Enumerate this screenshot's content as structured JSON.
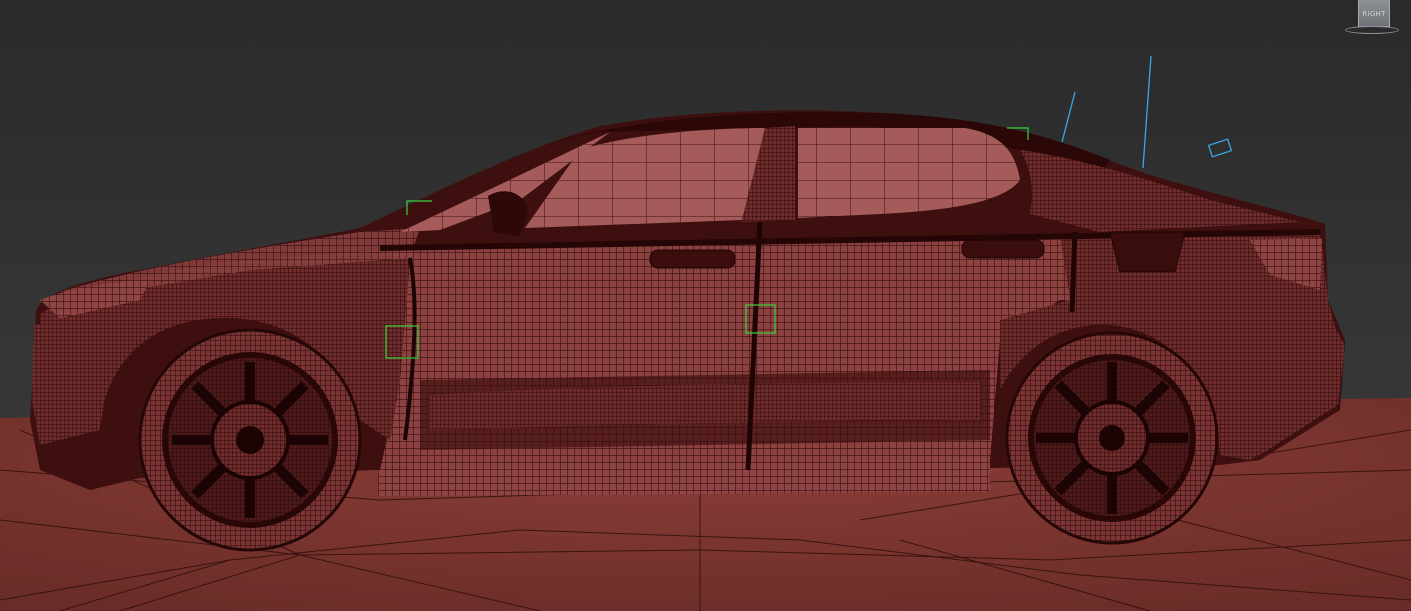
{
  "viewport": {
    "view_name": "Right",
    "shading": "edged-faces",
    "viewcube": {
      "face_label": "RIGHT"
    },
    "colors": {
      "background": "#2f2f2f",
      "mesh_body": "#4a1414",
      "mesh_light": "#a85a58",
      "ground": "#7a3630",
      "selection_box": "#3bd03b",
      "helper_lines": "#3aa6e8"
    },
    "objects": [
      {
        "name": "car-body",
        "type": "editable-mesh"
      },
      {
        "name": "front-wheel",
        "type": "editable-mesh"
      },
      {
        "name": "rear-wheel",
        "type": "editable-mesh"
      },
      {
        "name": "ground-plane",
        "type": "plane"
      },
      {
        "name": "light-helper",
        "type": "helper"
      }
    ]
  }
}
